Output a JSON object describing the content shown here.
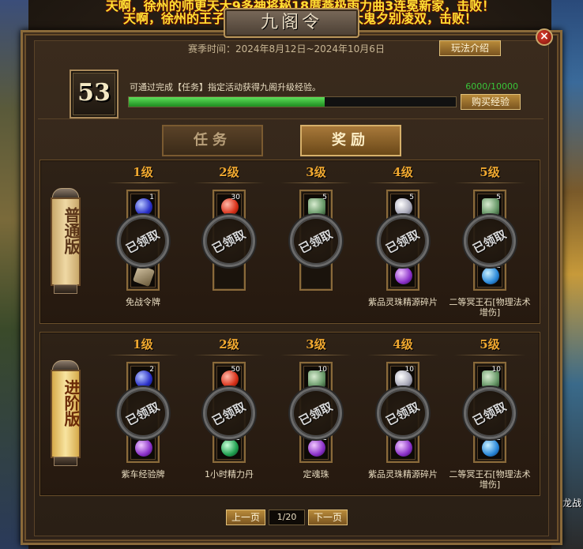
{
  "broadcast": {
    "line1": "天啊，徐州的师更天大9多神将秘18厝燕极雨力曲3连冕新家，击败！",
    "line2": "天啊，徐州的王子与外交天风一神宜相逢大鬼夕别凌双，击败！"
  },
  "side_text": "龙战",
  "window": {
    "title": "九阁令",
    "close_label": "×",
    "season": "赛季时间：2024年8月12日~2024年10月6日",
    "rules_button": "玩法介绍"
  },
  "progress": {
    "level": "53",
    "description": "可通过完成【任务】指定活动获得九阁升级经验。",
    "exp_text": "6000/10000",
    "exp_fraction": 0.6,
    "buy_button": "购买经验"
  },
  "tabs": [
    {
      "label": "任务",
      "active": false
    },
    {
      "label": "奖励",
      "active": true
    }
  ],
  "claimed_label": "已领取",
  "tracks": [
    {
      "name": "普通版",
      "levels": [
        {
          "label": "1级",
          "top_gem": "blue",
          "top_count": "1",
          "bottom_gem": "token",
          "bottom_count": "",
          "name": "免战令牌"
        },
        {
          "label": "2级",
          "top_gem": "red",
          "top_count": "30",
          "bottom_gem": "",
          "bottom_count": "",
          "name": ""
        },
        {
          "label": "3级",
          "top_gem": "jade",
          "top_count": "5",
          "bottom_gem": "",
          "bottom_count": "",
          "name": ""
        },
        {
          "label": "4级",
          "top_gem": "silver",
          "top_count": "5",
          "bottom_gem": "purple",
          "bottom_count": "",
          "name": "紫品灵珠精源碎片"
        },
        {
          "label": "5级",
          "top_gem": "jade",
          "top_count": "5",
          "bottom_gem": "cyan",
          "bottom_count": "2",
          "name": "二等冥王石[物理法术增伤]"
        }
      ]
    },
    {
      "name": "进阶版",
      "levels": [
        {
          "label": "1级",
          "top_gem": "blue",
          "top_count": "2",
          "bottom_gem": "purple",
          "bottom_count": "",
          "name": "紫车经验牌"
        },
        {
          "label": "2级",
          "top_gem": "red",
          "top_count": "50",
          "bottom_gem": "green",
          "bottom_count": "1",
          "name": "1小时精力丹"
        },
        {
          "label": "3级",
          "top_gem": "jade",
          "top_count": "10",
          "bottom_gem": "purple",
          "bottom_count": "1",
          "name": "定魂珠"
        },
        {
          "label": "4级",
          "top_gem": "silver",
          "top_count": "10",
          "bottom_gem": "purple",
          "bottom_count": "",
          "name": "紫品灵珠精源碎片"
        },
        {
          "label": "5级",
          "top_gem": "jade",
          "top_count": "10",
          "bottom_gem": "cyan",
          "bottom_count": "2",
          "name": "二等冥王石[物理法术增伤]"
        }
      ]
    }
  ],
  "pagination": {
    "prev": "上一页",
    "page": "1/20",
    "next": "下一页"
  }
}
